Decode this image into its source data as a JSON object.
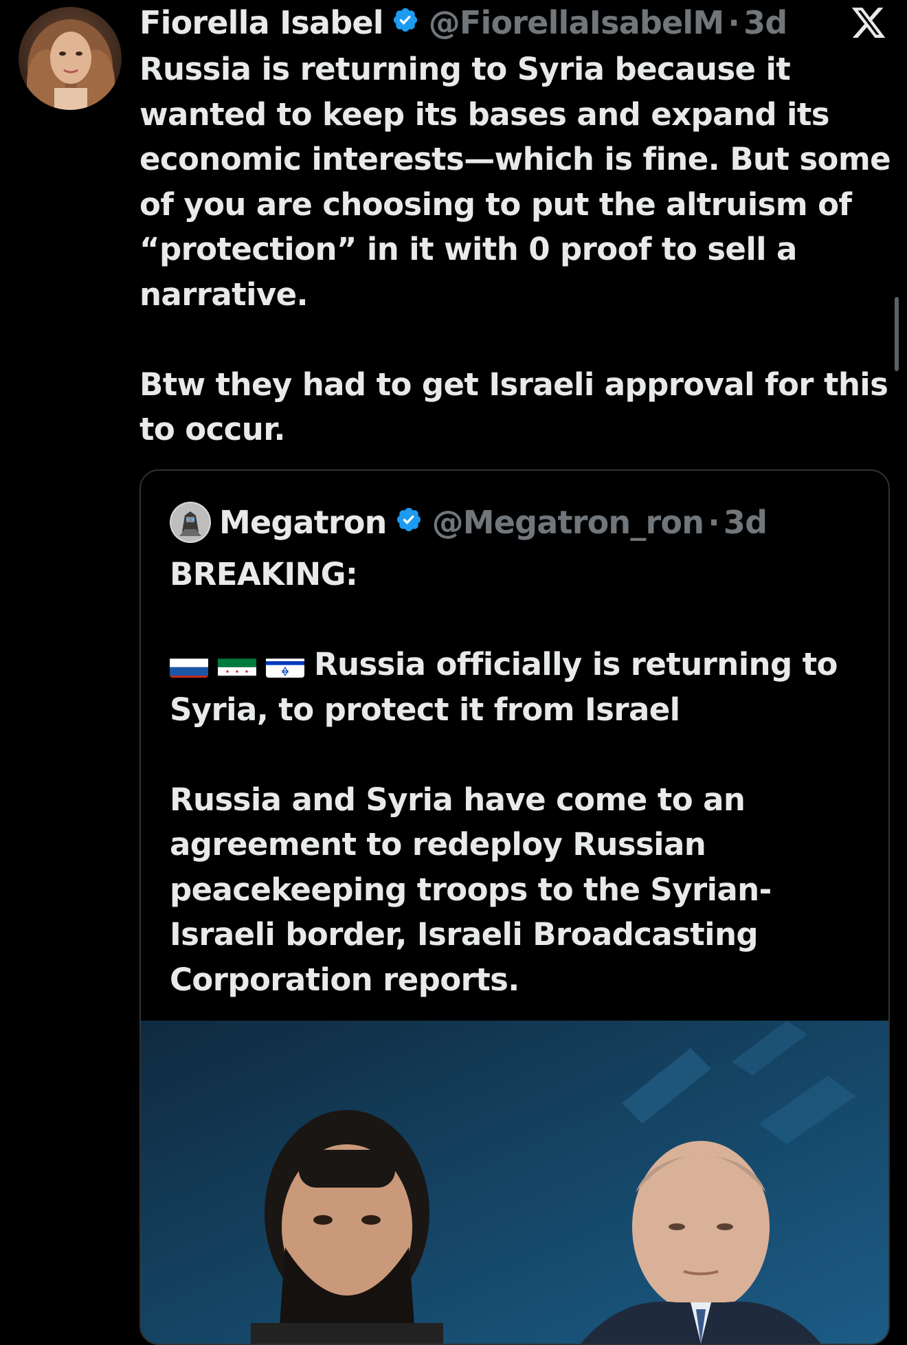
{
  "tweet": {
    "author_name": "Fiorella Isabel",
    "author_handle": "@FiorellaIsabelM",
    "separator": "·",
    "time": "3d",
    "paragraphs": [
      "Russia is returning to Syria because it wanted to keep its bases and expand its economic interests—which is fine. But some of you are choosing to put the altruism of “protection” in it with 0 proof to sell a narrative.",
      "Btw they had to get Israeli approval for this to occur."
    ]
  },
  "quoted_tweet": {
    "author_name": "Megatron",
    "author_handle": "@Megatron_ron",
    "separator": "·",
    "time": "3d",
    "headline": "BREAKING:",
    "flag_line": "Russia officially is returning to Syria, to protect it from Israel",
    "body": "Russia and Syria have come to an agreement to redeploy Russian peacekeeping troops to the Syrian-Israeli border, Israeli Broadcasting Corporation reports."
  },
  "icons": {
    "verified": "verified-badge-icon",
    "platform": "x-logo-icon",
    "flags": [
      "russia-flag-icon",
      "syria-flag-icon",
      "israel-flag-icon"
    ]
  },
  "colors": {
    "background": "#000000",
    "text_primary": "#e7e9ea",
    "text_secondary": "#71767b",
    "verified_blue": "#1d9bf0",
    "card_border": "#2f3336"
  }
}
